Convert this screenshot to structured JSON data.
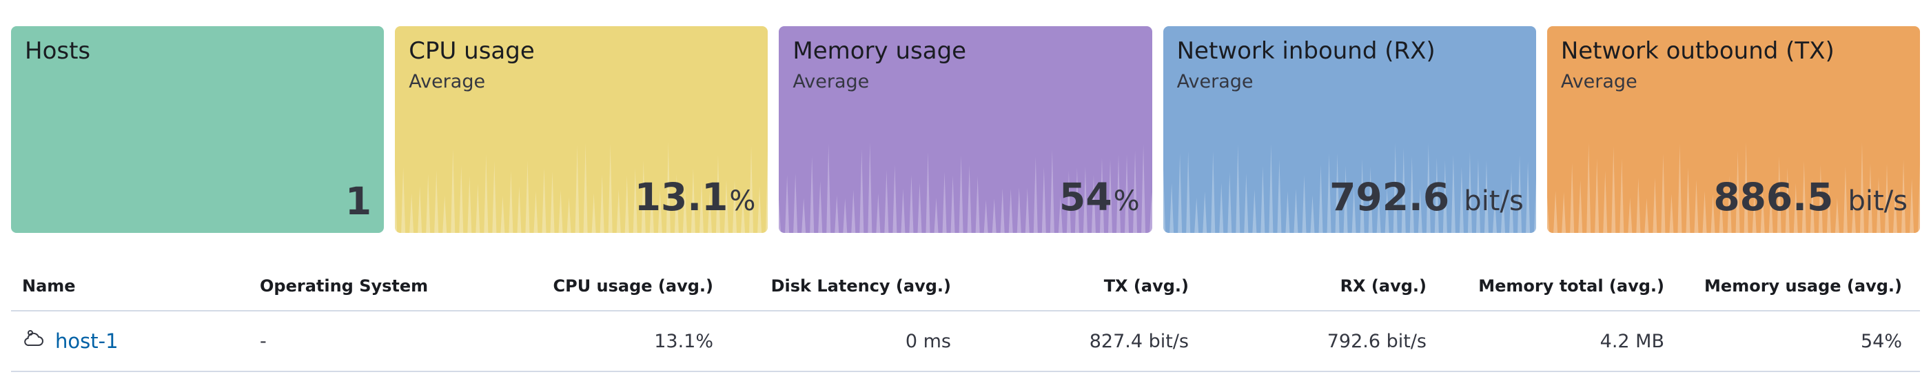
{
  "colors": {
    "hosts": "#83c9b1",
    "cpu": "#ebd77d",
    "memory": "#a38acd",
    "rx": "#80a9d6",
    "tx": "#eca55f"
  },
  "cards": {
    "hosts": {
      "title": "Hosts",
      "value": "1"
    },
    "cpu": {
      "title": "CPU usage",
      "subtitle": "Average",
      "value": "13.1",
      "unit": "%"
    },
    "memory": {
      "title": "Memory usage",
      "subtitle": "Average",
      "value": "54",
      "unit": "%"
    },
    "rx": {
      "title": "Network inbound (RX)",
      "subtitle": "Average",
      "value": "792.6",
      "unit": "bit/s"
    },
    "tx": {
      "title": "Network outbound (TX)",
      "subtitle": "Average",
      "value": "886.5",
      "unit": "bit/s"
    }
  },
  "table": {
    "headers": {
      "name": "Name",
      "os": "Operating System",
      "cpu": "CPU usage (avg.)",
      "disk": "Disk Latency (avg.)",
      "tx": "TX (avg.)",
      "rx": "RX (avg.)",
      "mem_total": "Memory total (avg.)",
      "mem_usage": "Memory usage (avg.)"
    },
    "rows": [
      {
        "icon": "cloud-provider-icon",
        "name": "host-1",
        "os": "-",
        "cpu": "13.1%",
        "disk": "0 ms",
        "tx": "827.4 bit/s",
        "rx": "792.6 bit/s",
        "mem_total": "4.2 MB",
        "mem_usage": "54%"
      }
    ]
  }
}
